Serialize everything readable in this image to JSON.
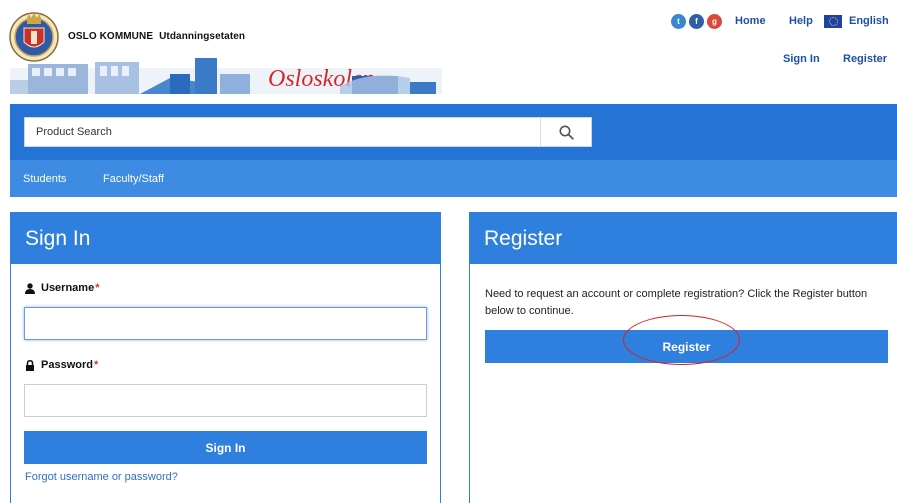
{
  "header": {
    "org_name": "OSLO KOMMUNE",
    "agency": "Utdanningsetaten",
    "banner_text": "Osloskolen",
    "social": [
      "twitter-icon",
      "facebook-icon",
      "google-plus-icon"
    ],
    "links": {
      "home": "Home",
      "help": "Help",
      "language": "English",
      "sign_in": "Sign In",
      "register": "Register"
    }
  },
  "search": {
    "placeholder": "Product Search"
  },
  "nav": {
    "items": [
      "Students",
      "Faculty/Staff"
    ]
  },
  "sign_in_panel": {
    "title": "Sign In",
    "username_label": "Username",
    "password_label": "Password",
    "required_mark": "*",
    "username_value": "",
    "password_value": "",
    "button": "Sign In",
    "forgot_link": "Forgot username or password?"
  },
  "register_panel": {
    "title": "Register",
    "text": "Need to request an account or complete registration? Click the Register button below to continue.",
    "button": "Register"
  },
  "colors": {
    "primary": "#2f7fde",
    "band": "#2673d6",
    "nav": "#3d8be2",
    "link": "#1e4fa5",
    "highlight_circle": "#d42424",
    "required": "#d0392b"
  }
}
